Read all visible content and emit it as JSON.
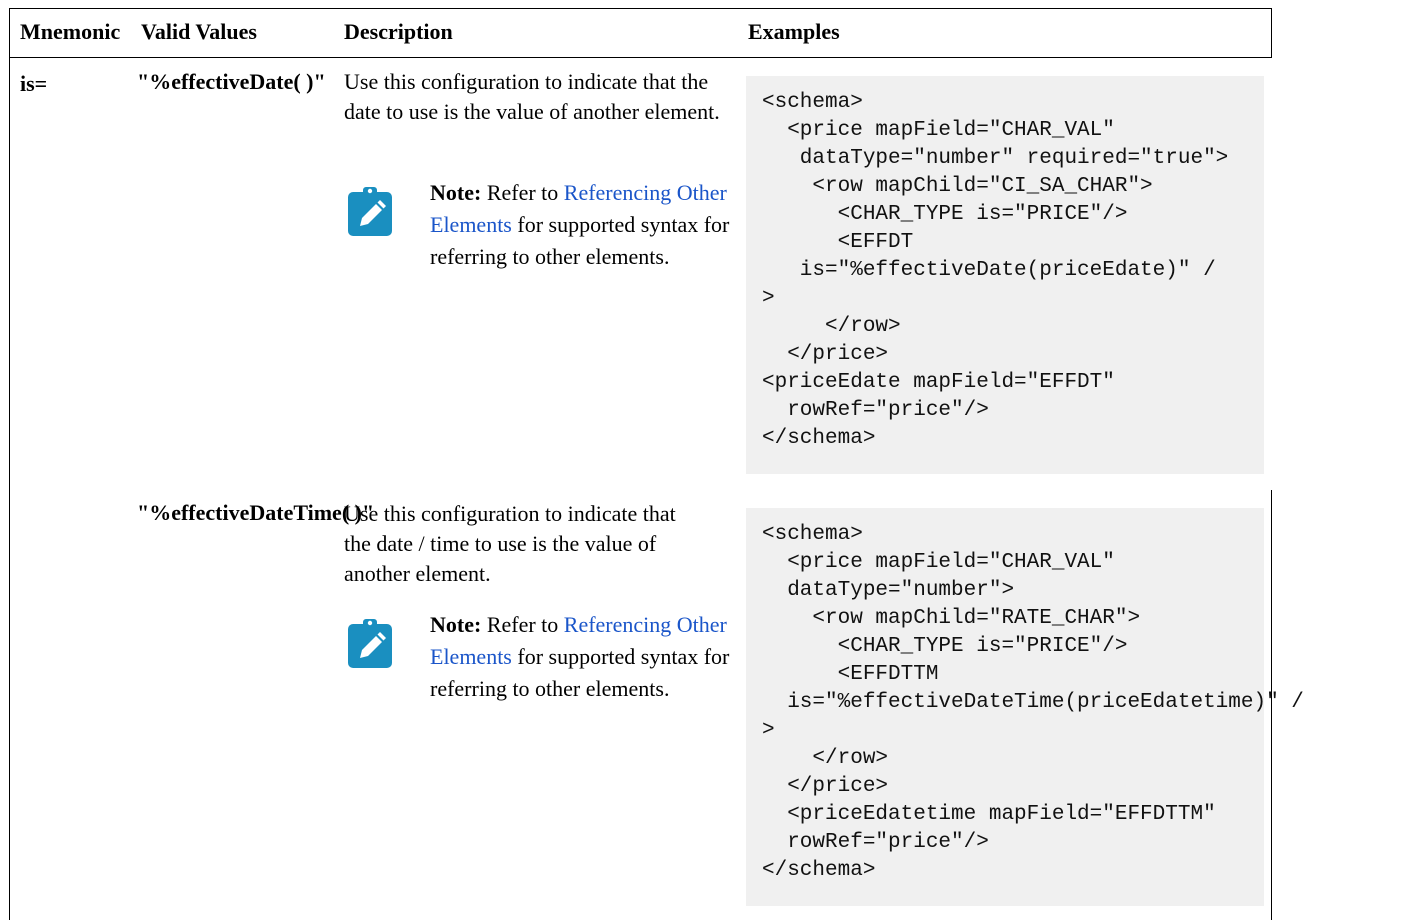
{
  "table": {
    "headers": {
      "mnemonic": "Mnemonic",
      "valid_values": "Valid Values",
      "description": "Description",
      "examples": "Examples"
    },
    "rows": [
      {
        "mnemonic": "is=",
        "valid_value": "\"%effectiveDate( )\"",
        "description": "Use this configuration to indicate that the date to use is the value of another element.",
        "note_label": "Note:",
        "note_prefix": "Refer to",
        "note_link": "Referencing Other Elements",
        "note_suffix": "for supported syntax for referring to other elements.",
        "example": "<schema>\n  <price mapField=\"CHAR_VAL\"\n   dataType=\"number\" required=\"true\">\n    <row mapChild=\"CI_SA_CHAR\">\n      <CHAR_TYPE is=\"PRICE\"/>\n      <EFFDT\n   is=\"%effectiveDate(priceEdate)\" /\n>\n     </row>\n  </price>\n<priceEdate mapField=\"EFFDT\"\n  rowRef=\"price\"/>\n</schema>"
      },
      {
        "mnemonic": "",
        "valid_value": "\"%effectiveDateTime( )\"",
        "description": "Use this configuration to indicate that the date / time to use is the value of another element.",
        "note_label": "Note:",
        "note_prefix": "Refer to",
        "note_link": "Referencing Other Elements",
        "note_suffix": "for supported syntax for referring to other elements.",
        "example": "<schema>\n  <price mapField=\"CHAR_VAL\"\n  dataType=\"number\">\n    <row mapChild=\"RATE_CHAR\">\n      <CHAR_TYPE is=\"PRICE\"/>\n      <EFFDTTM\n  is=\"%effectiveDateTime(priceEdatetime)\" /\n>\n    </row>\n  </price>\n  <priceEdatetime mapField=\"EFFDTTM\"\n  rowRef=\"price\"/>\n</schema>"
      }
    ]
  },
  "colors": {
    "link": "#1a55c9",
    "note_icon": "#1a8fc0",
    "code_background": "#f0f0f0"
  },
  "icons": {
    "note": "pencil-note-icon"
  }
}
